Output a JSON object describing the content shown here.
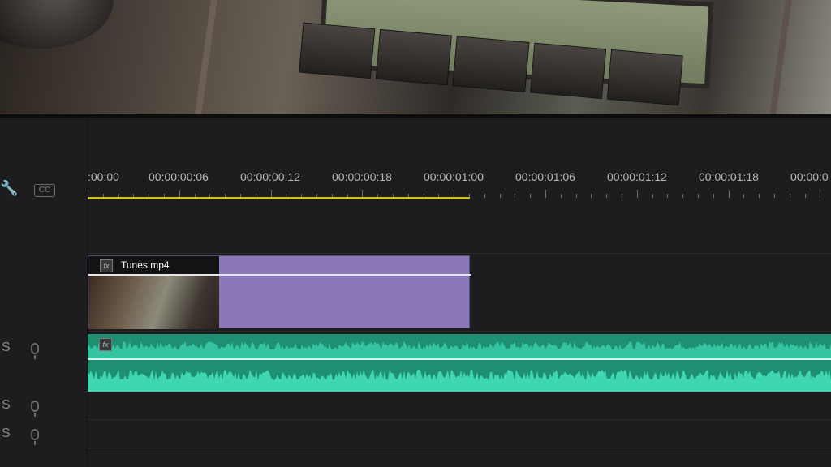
{
  "timeline": {
    "timecodes": [
      ":00:00",
      "00:00:00:06",
      "00:00:00:12",
      "00:00:00:18",
      "00:00:01:00",
      "00:00:01:06",
      "00:00:01:12",
      "00:00:01:18",
      "00:00:0"
    ],
    "video_clip": {
      "name": "Tunes.mp4",
      "fx_label": "fx"
    },
    "audio_clip": {
      "fx_label": "fx"
    },
    "track_labels": [
      "S",
      "S",
      "S"
    ],
    "work_area_color": "#c9c61a",
    "video_clip_color": "#8a78b8",
    "audio_clip_color": "#1f8f72"
  },
  "tools": {
    "cc_label": "CC",
    "wrench_icon": "wrench-icon"
  }
}
